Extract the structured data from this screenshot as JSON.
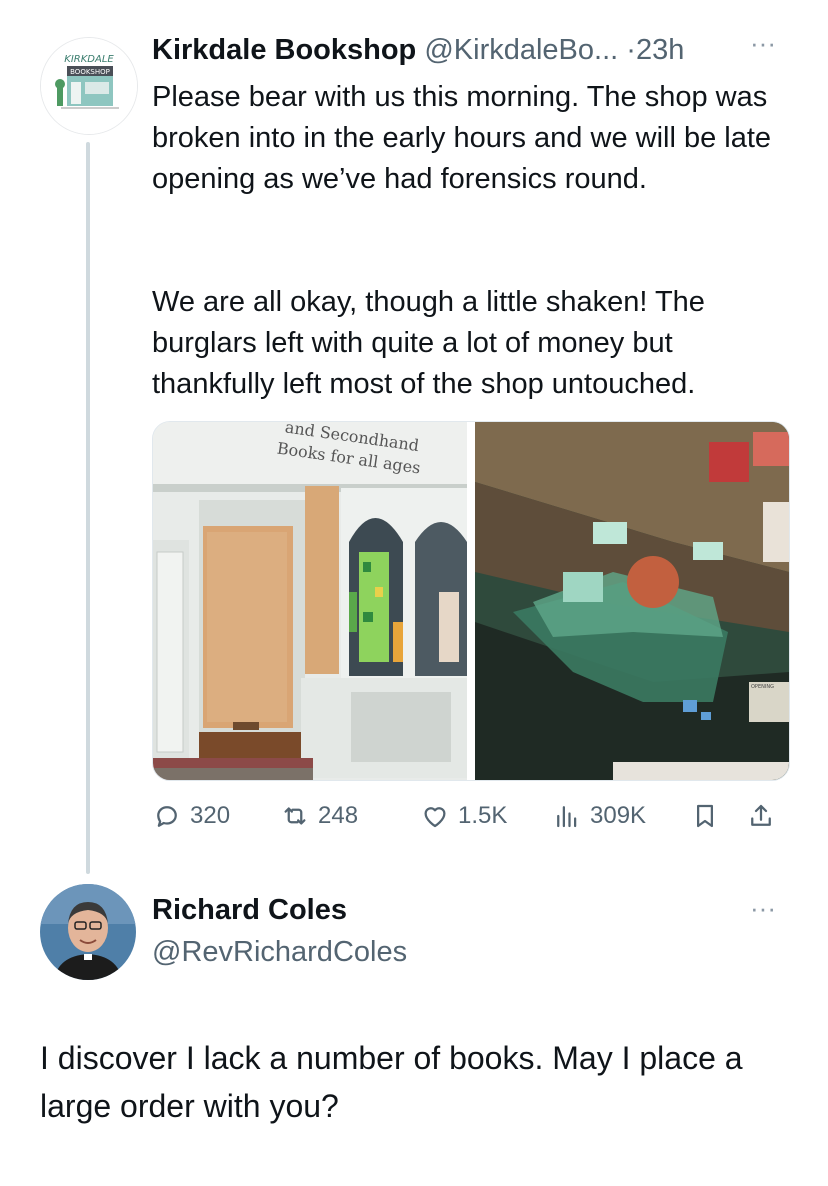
{
  "tweet1": {
    "author_name": "Kirkdale Bookshop",
    "handle": "@KirkdaleBo...",
    "separator": "·",
    "time": "23h",
    "more": "···",
    "text_p1": "Please bear with us this morning. The shop was broken into in the early hours and we will be late opening as we’ve had forensics round.",
    "text_p2": "We are all okay, though a little shaken! The burglars left with quite a lot of money but thankfully left most of the shop untouched.",
    "avatar_logo": "KIRKDALE BOOKSHOP",
    "media": {
      "sign_line1": "and Secondhand",
      "sign_line2": "Books for all ages",
      "poster_text": "OPENING"
    },
    "actions": {
      "replies": "320",
      "retweets": "248",
      "likes": "1.5K",
      "views": "309K"
    }
  },
  "tweet2": {
    "author_name": "Richard Coles",
    "handle": "@RevRichardColes",
    "more": "···",
    "text": "I discover I lack a number of books. May I place a large order with you?"
  },
  "icons": {
    "reply": "reply-icon",
    "retweet": "retweet-icon",
    "like": "heart-icon",
    "views": "bar-chart-icon",
    "bookmark": "bookmark-icon",
    "share": "share-icon"
  }
}
